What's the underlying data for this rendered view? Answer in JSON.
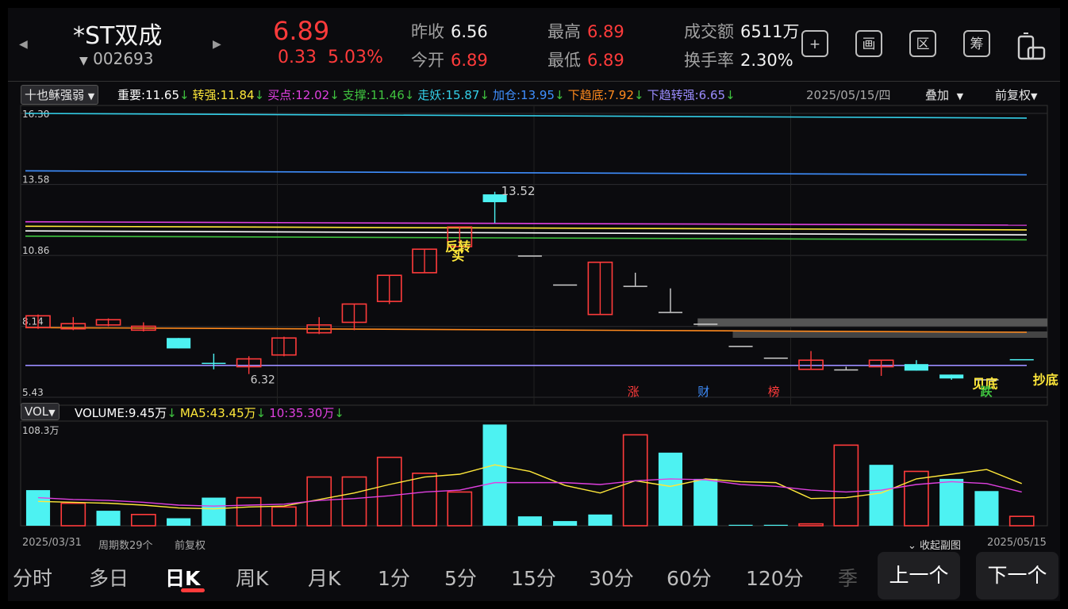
{
  "stock": {
    "name": "*ST双成",
    "code": "002693",
    "price": "6.89",
    "change": "0.33",
    "change_pct": "5.03%"
  },
  "quote": {
    "prev_close_label": "昨收",
    "prev_close": "6.56",
    "open_label": "今开",
    "open": "6.89",
    "high_label": "最高",
    "high": "6.89",
    "low_label": "最低",
    "low": "6.89",
    "amount_label": "成交额",
    "amount": "6511万",
    "turnover_label": "换手率",
    "turnover": "2.30%"
  },
  "toolbar": {
    "icons": [
      "add-icon",
      "draw-icon",
      "region-icon",
      "chips-icon",
      "device-icon"
    ],
    "labels": [
      "+",
      "画",
      "区",
      "筹",
      ""
    ]
  },
  "indicator": {
    "name": "十也稣强弱",
    "items": [
      {
        "label": "重要:",
        "value": "11.65",
        "arrow": "↓",
        "color": "#ffffff"
      },
      {
        "label": "转强:",
        "value": "11.84",
        "arrow": "↓",
        "color": "#ffe83a"
      },
      {
        "label": "买点:",
        "value": "12.02",
        "arrow": "↓",
        "color": "#e040e0"
      },
      {
        "label": "支撑:",
        "value": "11.46",
        "arrow": "↓",
        "color": "#3fc23f"
      },
      {
        "label": "走妖:",
        "value": "15.87",
        "arrow": "↓",
        "color": "#33cfe8"
      },
      {
        "label": "加仓:",
        "value": "13.95",
        "arrow": "↓",
        "color": "#3f8fff"
      },
      {
        "label": "下趋底:",
        "value": "7.92",
        "arrow": "↓",
        "color": "#ff8a1e"
      },
      {
        "label": "下趋转强:",
        "value": "6.65",
        "arrow": "↓",
        "color": "#9b8cff"
      }
    ],
    "date": "2025/05/15/四",
    "overlay": "叠加",
    "adjust": "前复权"
  },
  "chart_data": {
    "type": "candlestick",
    "y_ticks": [
      "16.30",
      "13.58",
      "10.86",
      "8.14",
      "5.43"
    ],
    "ylim": [
      5.43,
      16.3
    ],
    "candles": [
      {
        "o": 8.1,
        "c": 8.55,
        "h": 8.6,
        "l": 8.05
      },
      {
        "o": 8.05,
        "c": 8.25,
        "h": 8.5,
        "l": 8.0
      },
      {
        "o": 8.2,
        "c": 8.4,
        "h": 8.45,
        "l": 8.15
      },
      {
        "o": 8.0,
        "c": 8.15,
        "h": 8.3,
        "l": 7.95
      },
      {
        "o": 7.7,
        "c": 7.3,
        "h": 7.7,
        "l": 7.3
      },
      {
        "o": 6.75,
        "c": 6.75,
        "h": 7.1,
        "l": 6.5
      },
      {
        "o": 6.6,
        "c": 6.9,
        "h": 7.0,
        "l": 6.32
      },
      {
        "o": 7.05,
        "c": 7.7,
        "h": 7.75,
        "l": 7.0
      },
      {
        "o": 7.9,
        "c": 8.2,
        "h": 8.5,
        "l": 7.85
      },
      {
        "o": 8.3,
        "c": 9.0,
        "h": 9.0,
        "l": 8.0
      },
      {
        "o": 9.1,
        "c": 10.1,
        "h": 10.1,
        "l": 9.0
      },
      {
        "o": 10.2,
        "c": 11.1,
        "h": 11.1,
        "l": 10.2
      },
      {
        "o": 11.2,
        "c": 11.95,
        "h": 11.95,
        "l": 11.2
      },
      {
        "o": 13.2,
        "c": 12.9,
        "h": 13.3,
        "l": 12.1
      },
      {
        "o": 10.86,
        "c": 10.86,
        "h": 10.86,
        "l": 10.86
      },
      {
        "o": 9.75,
        "c": 9.75,
        "h": 9.75,
        "l": 9.75
      },
      {
        "o": 8.6,
        "c": 10.6,
        "h": 10.6,
        "l": 8.6
      },
      {
        "o": 9.7,
        "c": 9.7,
        "h": 10.2,
        "l": 9.7
      },
      {
        "o": 8.7,
        "c": 8.7,
        "h": 9.6,
        "l": 8.7
      },
      {
        "o": 8.25,
        "c": 8.25,
        "h": 8.25,
        "l": 8.25
      },
      {
        "o": 7.4,
        "c": 7.4,
        "h": 7.4,
        "l": 7.4
      },
      {
        "o": 6.95,
        "c": 6.95,
        "h": 6.95,
        "l": 6.95
      },
      {
        "o": 6.5,
        "c": 6.85,
        "h": 7.2,
        "l": 6.5
      },
      {
        "o": 6.5,
        "c": 6.5,
        "h": 6.6,
        "l": 6.5
      },
      {
        "o": 6.6,
        "c": 6.85,
        "h": 6.85,
        "l": 6.25
      },
      {
        "o": 6.7,
        "c": 6.45,
        "h": 6.85,
        "l": 6.45
      },
      {
        "o": 6.3,
        "c": 6.15,
        "h": 6.3,
        "l": 6.1
      },
      {
        "o": 6.12,
        "c": 6.12,
        "h": 6.12,
        "l": 6.12
      },
      {
        "o": 6.89,
        "c": 6.89,
        "h": 6.89,
        "l": 6.89
      }
    ],
    "candle_colors": {
      "up": "#ff3b3b",
      "down": "#4df2f2",
      "flat": "#cfcfcf"
    },
    "lines": [
      {
        "color": "#33cfe8",
        "from": 16.3,
        "to": 16.12
      },
      {
        "color": "#3f8fff",
        "from": 14.1,
        "to": 13.95
      },
      {
        "color": "#e040e0",
        "from": 12.15,
        "to": 12.02
      },
      {
        "color": "#ffe83a",
        "from": 11.98,
        "to": 11.84
      },
      {
        "color": "#ffffff",
        "from": 11.8,
        "to": 11.65
      },
      {
        "color": "#3fc23f",
        "from": 11.6,
        "to": 11.46
      },
      {
        "color": "#ff8a1e",
        "from": 8.1,
        "to": 7.92
      },
      {
        "color": "#9b8cff",
        "from": 6.65,
        "to": 6.65
      }
    ],
    "labels": [
      {
        "text": "13.52",
        "color": "#cfcfcf"
      },
      {
        "text": "6.32",
        "color": "#cfcfcf"
      },
      {
        "text": "反转",
        "color": "#ffe83a"
      },
      {
        "text": "买",
        "color": "#ffe83a"
      },
      {
        "text": "涨",
        "color": "#ff3b3b"
      },
      {
        "text": "财",
        "color": "#3f8fff"
      },
      {
        "text": "榜",
        "color": "#ff3b3b"
      },
      {
        "text": "见底",
        "color": "#ffe83a"
      },
      {
        "text": "抄底",
        "color": "#ffe83a"
      },
      {
        "text": "跌",
        "color": "#3fc23f"
      }
    ]
  },
  "volume": {
    "name": "VOL",
    "items": [
      {
        "label": "VOLUME:",
        "value": "9.45万",
        "arrow": "↓",
        "color": "#ffffff"
      },
      {
        "label": "MA5:",
        "value": "43.45万",
        "arrow": "↓",
        "color": "#ffe83a"
      },
      {
        "label": "10:",
        "value": "35.30万",
        "arrow": "↓",
        "color": "#e040e0"
      }
    ],
    "max_label": "108.3万",
    "max": 108.3,
    "bars": [
      38,
      24,
      16,
      12,
      8,
      30,
      30,
      20,
      52,
      52,
      73,
      56,
      36,
      108,
      10,
      5,
      12,
      97,
      78,
      50,
      1,
      1,
      2,
      86,
      65,
      58,
      50,
      37,
      10
    ],
    "ma5": [
      26,
      25,
      24,
      22,
      19,
      18,
      20,
      21,
      28,
      35,
      44,
      52,
      55,
      65,
      58,
      43,
      35,
      48,
      42,
      50,
      47,
      46,
      29,
      30,
      35,
      50,
      55,
      60,
      45
    ],
    "ma10": [
      30,
      28,
      27,
      25,
      22,
      21,
      22,
      23,
      27,
      29,
      32,
      36,
      38,
      46,
      46,
      46,
      44,
      48,
      50,
      49,
      44,
      42,
      38,
      36,
      38,
      44,
      47,
      45,
      36
    ],
    "ma5_color": "#ffe83a",
    "ma10_color": "#e040e0"
  },
  "footer": {
    "start_date": "2025/03/31",
    "period_count": "周期数29个",
    "adjust": "前复权",
    "collapse": "收起副图",
    "end_date": "2025/05/15"
  },
  "tabs": [
    "分时",
    "多日",
    "日K",
    "周K",
    "月K",
    "1分",
    "5分",
    "15分",
    "30分",
    "60分",
    "120分",
    "季"
  ],
  "active_tab": "日K",
  "nav": {
    "prev": "上一个",
    "next": "下一个"
  }
}
